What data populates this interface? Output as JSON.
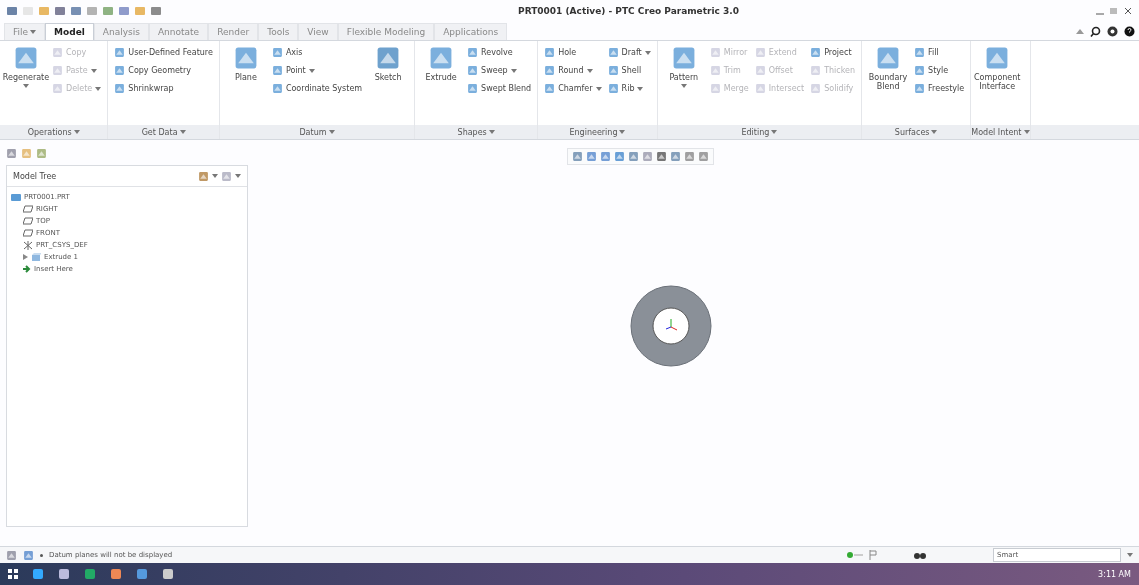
{
  "window": {
    "title": "PRT0001 (Active) - PTC Creo Parametric 3.0"
  },
  "tabs": [
    {
      "label": "File",
      "selected": false,
      "dropdown": true
    },
    {
      "label": "Model",
      "selected": true,
      "dropdown": false
    },
    {
      "label": "Analysis",
      "selected": false,
      "dropdown": false
    },
    {
      "label": "Annotate",
      "selected": false,
      "dropdown": false
    },
    {
      "label": "Render",
      "selected": false,
      "dropdown": false
    },
    {
      "label": "Tools",
      "selected": false,
      "dropdown": false
    },
    {
      "label": "View",
      "selected": false,
      "dropdown": false
    },
    {
      "label": "Flexible Modeling",
      "selected": false,
      "dropdown": false
    },
    {
      "label": "Applications",
      "selected": false,
      "dropdown": false
    }
  ],
  "ribbon": [
    {
      "label": "Operations",
      "columns": [
        {
          "kind": "large",
          "label": "Regenerate",
          "dropdown": true
        },
        {
          "kind": "stack",
          "items": [
            {
              "label": "Copy",
              "disabled": true,
              "dropdown": false
            },
            {
              "label": "Paste",
              "disabled": true,
              "dropdown": true
            },
            {
              "label": "Delete",
              "disabled": true,
              "dropdown": true
            }
          ]
        }
      ]
    },
    {
      "label": "Get Data",
      "columns": [
        {
          "kind": "stack",
          "items": [
            {
              "label": "User-Defined Feature",
              "disabled": false,
              "dropdown": false
            },
            {
              "label": "Copy Geometry",
              "disabled": false,
              "dropdown": false
            },
            {
              "label": "Shrinkwrap",
              "disabled": false,
              "dropdown": false
            }
          ]
        }
      ]
    },
    {
      "label": "Datum",
      "columns": [
        {
          "kind": "large",
          "label": "Plane",
          "dropdown": false
        },
        {
          "kind": "stack",
          "items": [
            {
              "label": "Axis",
              "disabled": false,
              "dropdown": false
            },
            {
              "label": "Point",
              "disabled": false,
              "dropdown": true
            },
            {
              "label": "Coordinate System",
              "disabled": false,
              "dropdown": false
            }
          ]
        },
        {
          "kind": "large",
          "label": "Sketch",
          "dropdown": false
        }
      ]
    },
    {
      "label": "Shapes",
      "columns": [
        {
          "kind": "large",
          "label": "Extrude",
          "dropdown": false
        },
        {
          "kind": "stack",
          "items": [
            {
              "label": "Revolve",
              "disabled": false,
              "dropdown": false
            },
            {
              "label": "Sweep",
              "disabled": false,
              "dropdown": true
            },
            {
              "label": "Swept Blend",
              "disabled": false,
              "dropdown": false
            }
          ]
        }
      ]
    },
    {
      "label": "Engineering",
      "columns": [
        {
          "kind": "stack",
          "items": [
            {
              "label": "Hole",
              "disabled": false,
              "dropdown": false
            },
            {
              "label": "Round",
              "disabled": false,
              "dropdown": true
            },
            {
              "label": "Chamfer",
              "disabled": false,
              "dropdown": true
            }
          ]
        },
        {
          "kind": "stack",
          "items": [
            {
              "label": "Draft",
              "disabled": false,
              "dropdown": true
            },
            {
              "label": "Shell",
              "disabled": false,
              "dropdown": false
            },
            {
              "label": "Rib",
              "disabled": false,
              "dropdown": true
            }
          ]
        }
      ]
    },
    {
      "label": "Editing",
      "columns": [
        {
          "kind": "large",
          "label": "Pattern",
          "dropdown": true
        },
        {
          "kind": "stack",
          "items": [
            {
              "label": "Mirror",
              "disabled": true,
              "dropdown": false
            },
            {
              "label": "Trim",
              "disabled": true,
              "dropdown": false
            },
            {
              "label": "Merge",
              "disabled": true,
              "dropdown": false
            }
          ]
        },
        {
          "kind": "stack",
          "items": [
            {
              "label": "Extend",
              "disabled": true,
              "dropdown": false
            },
            {
              "label": "Offset",
              "disabled": true,
              "dropdown": false
            },
            {
              "label": "Intersect",
              "disabled": true,
              "dropdown": false
            }
          ]
        },
        {
          "kind": "stack",
          "items": [
            {
              "label": "Project",
              "disabled": false,
              "dropdown": false
            },
            {
              "label": "Thicken",
              "disabled": true,
              "dropdown": false
            },
            {
              "label": "Solidify",
              "disabled": true,
              "dropdown": false
            }
          ]
        }
      ]
    },
    {
      "label": "Surfaces",
      "columns": [
        {
          "kind": "large",
          "label": "Boundary Blend",
          "dropdown": false
        },
        {
          "kind": "stack",
          "items": [
            {
              "label": "Fill",
              "disabled": false,
              "dropdown": false
            },
            {
              "label": "Style",
              "disabled": false,
              "dropdown": false
            },
            {
              "label": "Freestyle",
              "disabled": false,
              "dropdown": false
            }
          ]
        }
      ]
    },
    {
      "label": "Model Intent",
      "columns": [
        {
          "kind": "large",
          "label": "Component Interface",
          "dropdown": false
        }
      ]
    }
  ],
  "model_tree": {
    "title": "Model Tree",
    "items": [
      {
        "label": "PRT0001.PRT",
        "kind": "part",
        "expanded": true,
        "children": [
          {
            "label": "RIGHT",
            "kind": "plane"
          },
          {
            "label": "TOP",
            "kind": "plane"
          },
          {
            "label": "FRONT",
            "kind": "plane"
          },
          {
            "label": "PRT_CSYS_DEF",
            "kind": "csys"
          },
          {
            "label": "Extrude 1",
            "kind": "extrude",
            "expanded": false
          },
          {
            "label": "Insert Here",
            "kind": "insert"
          }
        ]
      }
    ]
  },
  "status_bar": {
    "message": "Datum planes will not be displayed",
    "filter": "Smart"
  },
  "taskbar": {
    "time": "3:11 AM"
  }
}
